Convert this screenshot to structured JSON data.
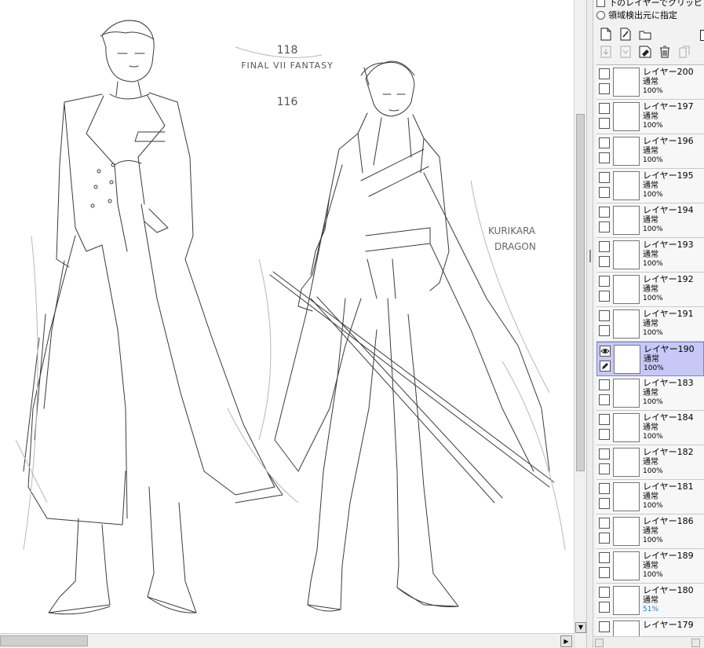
{
  "panel": {
    "options": {
      "clip_lower_layer": "下のレイヤーでクリッピング",
      "selection_source": "領域検出元に指定"
    },
    "toolbar_row1": [
      "new-layer-icon",
      "new-linework-layer-icon",
      "new-folder-icon"
    ],
    "toolbar_row2": [
      "transfer-down-icon",
      "merge-down-icon",
      "clear-layer-icon",
      "delete-layer-icon",
      "layer-settings-icon"
    ],
    "layers": [
      {
        "name": "レイヤー200",
        "mode": "通常",
        "opacity": "100%",
        "selected": false
      },
      {
        "name": "レイヤー197",
        "mode": "通常",
        "opacity": "100%",
        "selected": false
      },
      {
        "name": "レイヤー196",
        "mode": "通常",
        "opacity": "100%",
        "selected": false
      },
      {
        "name": "レイヤー195",
        "mode": "通常",
        "opacity": "100%",
        "selected": false
      },
      {
        "name": "レイヤー194",
        "mode": "通常",
        "opacity": "100%",
        "selected": false
      },
      {
        "name": "レイヤー193",
        "mode": "通常",
        "opacity": "100%",
        "selected": false
      },
      {
        "name": "レイヤー192",
        "mode": "通常",
        "opacity": "100%",
        "selected": false
      },
      {
        "name": "レイヤー191",
        "mode": "通常",
        "opacity": "100%",
        "selected": false
      },
      {
        "name": "レイヤー190",
        "mode": "通常",
        "opacity": "100%",
        "selected": true
      },
      {
        "name": "レイヤー183",
        "mode": "通常",
        "opacity": "100%",
        "selected": false
      },
      {
        "name": "レイヤー184",
        "mode": "通常",
        "opacity": "100%",
        "selected": false
      },
      {
        "name": "レイヤー182",
        "mode": "通常",
        "opacity": "100%",
        "selected": false
      },
      {
        "name": "レイヤー181",
        "mode": "通常",
        "opacity": "100%",
        "selected": false
      },
      {
        "name": "レイヤー186",
        "mode": "通常",
        "opacity": "100%",
        "selected": false
      },
      {
        "name": "レイヤー189",
        "mode": "通常",
        "opacity": "100%",
        "selected": false
      },
      {
        "name": "レイヤー180",
        "mode": "通常",
        "opacity": "51%",
        "selected": false
      },
      {
        "name": "レイヤー179",
        "mode": "",
        "opacity": "",
        "selected": false
      }
    ]
  },
  "canvas": {
    "annotation_lines": [
      "118",
      "FINAL VII FANTASY",
      "116"
    ],
    "label_lines": [
      "KURIKARA",
      "DRAGON"
    ]
  },
  "colors": {
    "selected_layer": "#c8c8f6",
    "panel_bg": "#f2f2f2",
    "sketch_stroke": "#444444"
  }
}
